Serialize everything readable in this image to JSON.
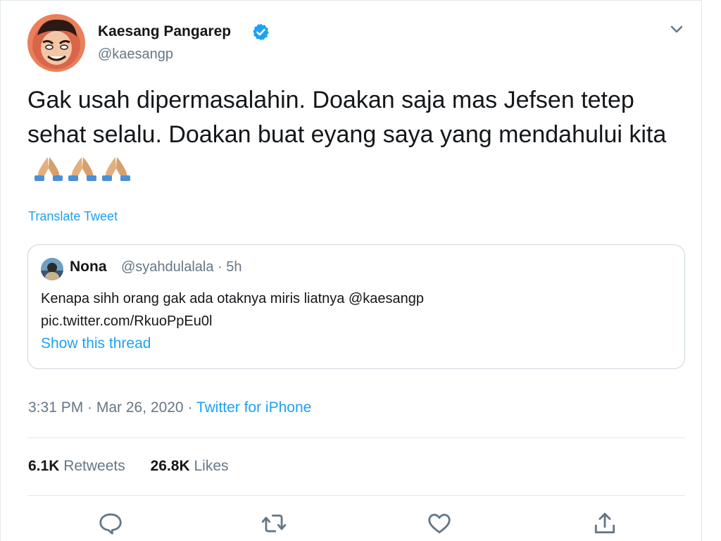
{
  "author": {
    "name": "Kaesang Pangarep",
    "handle": "@kaesangp",
    "verified": true
  },
  "tweet": {
    "text": "Gak usah dipermasalahin. Doakan saja mas Jefsen tetep sehat selalu. Doakan buat eyang saya yang mendahului kita",
    "emojis": [
      "folded-hands",
      "folded-hands",
      "folded-hands"
    ],
    "translate_label": "Translate Tweet"
  },
  "quoted": {
    "name": "Nona",
    "meta": "@syahdulalala · 5h",
    "text_line1": "Kenapa sihh orang gak ada otaknya miris liatnya @kaesangp",
    "text_line2": "pic.twitter.com/RkuoPpEu0l",
    "thread_label": "Show this thread"
  },
  "timestamp": {
    "time_date": "3:31 PM · Mar 26, 2020 · ",
    "source": "Twitter for iPhone"
  },
  "stats": {
    "retweets_count": "6.1K",
    "retweets_label": "Retweets",
    "likes_count": "26.8K",
    "likes_label": "Likes"
  },
  "actions": [
    "reply-icon",
    "retweet-icon",
    "like-icon",
    "share-icon"
  ],
  "colors": {
    "accent": "#1da1f2",
    "text": "#14171a",
    "secondary": "#657786",
    "border": "#e1e8ed"
  }
}
